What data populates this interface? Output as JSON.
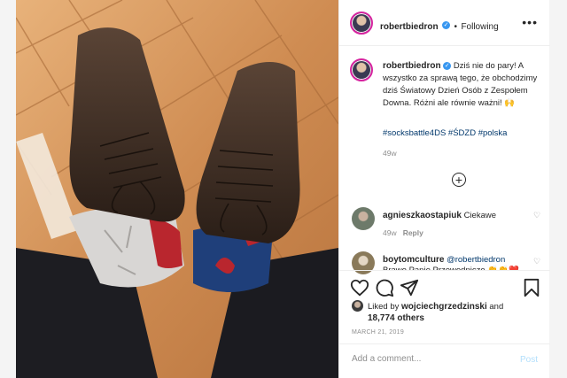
{
  "post": {
    "username": "robertbiedron",
    "verified_mark": "✓",
    "separator": "•",
    "follow_state": "Following",
    "more_glyph": "•••",
    "caption": "Dziś nie do pary! A wszystko za sprawą tego, że obchodzimy dziś Światowy Dzień Osób z Zespołem Downa. Różni ale równie ważni! 🙌",
    "hashtags": "#socksbattle4DS #ŚDZD #polska",
    "caption_age": "49w",
    "load_more_glyph": "+"
  },
  "comments": [
    {
      "username": "agnieszkaostapiuk",
      "text": "Ciekawe",
      "age": "49w",
      "reply_label": "Reply"
    },
    {
      "username": "boytomculture",
      "mention": "@robertbiedron",
      "text": "Brawo Panie Przewodnicze 👏👏❤️"
    }
  ],
  "likes": {
    "prefix": "Liked by",
    "liker": "wojciechgrzedzinski",
    "and": "and",
    "others": "18,774 others"
  },
  "date": "MARCH 21, 2019",
  "add_comment": {
    "placeholder": "Add a comment...",
    "post_label": "Post"
  },
  "icons": [
    "more-options-icon",
    "verified-icon",
    "heart-icon",
    "comment-icon",
    "share-icon",
    "bookmark-icon",
    "load-more-icon"
  ],
  "colors": {
    "link": "#00376b",
    "verified": "#3897f0",
    "muted": "#8e8e8e",
    "post_disabled": "#b2dffc"
  }
}
